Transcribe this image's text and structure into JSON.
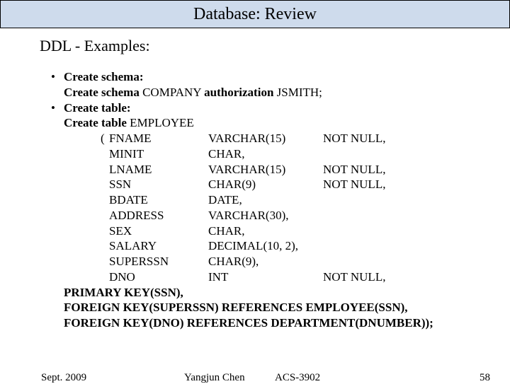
{
  "title": "Database: Review",
  "section": "DDL - Examples:",
  "b1_label": "Create schema:",
  "b1_stmt_a": "Create schema",
  "b1_stmt_b": " COMPANY ",
  "b1_stmt_c": "authorization",
  "b1_stmt_d": " JSMITH;",
  "b2_label": "Create table:",
  "b2_stmt_a": "Create table",
  "b2_stmt_b": " EMPLOYEE",
  "rows": [
    {
      "open": "(",
      "name": "FNAME",
      "type": "VARCHAR(15)",
      "cons": "NOT NULL,"
    },
    {
      "open": "",
      "name": "MINIT",
      "type": "CHAR,",
      "cons": ""
    },
    {
      "open": "",
      "name": "LNAME",
      "type": "VARCHAR(15)",
      "cons": "NOT NULL,"
    },
    {
      "open": "",
      "name": "SSN",
      "type": "CHAR(9)",
      "cons": "NOT NULL,"
    },
    {
      "open": "",
      "name": "BDATE",
      "type": "DATE,",
      "cons": ""
    },
    {
      "open": "",
      "name": "ADDRESS",
      "type": "VARCHAR(30),",
      "cons": ""
    },
    {
      "open": "",
      "name": "SEX",
      "type": "CHAR,",
      "cons": ""
    },
    {
      "open": "",
      "name": "SALARY",
      "type": "DECIMAL(10, 2),",
      "cons": ""
    },
    {
      "open": "",
      "name": "SUPERSSN",
      "type": "CHAR(9),",
      "cons": ""
    },
    {
      "open": "",
      "name": "DNO",
      "type": "INT",
      "cons": "NOT NULL,"
    }
  ],
  "pk": "PRIMARY KEY(SSN),",
  "fk1": "FOREIGN KEY(SUPERSSN) REFERENCES EMPLOYEE(SSN),",
  "fk2": "FOREIGN KEY(DNO) REFERENCES DEPARTMENT(DNUMBER));",
  "footer": {
    "date": "Sept. 2009",
    "author": "Yangjun Chen",
    "course": "ACS-3902",
    "page": "58"
  }
}
